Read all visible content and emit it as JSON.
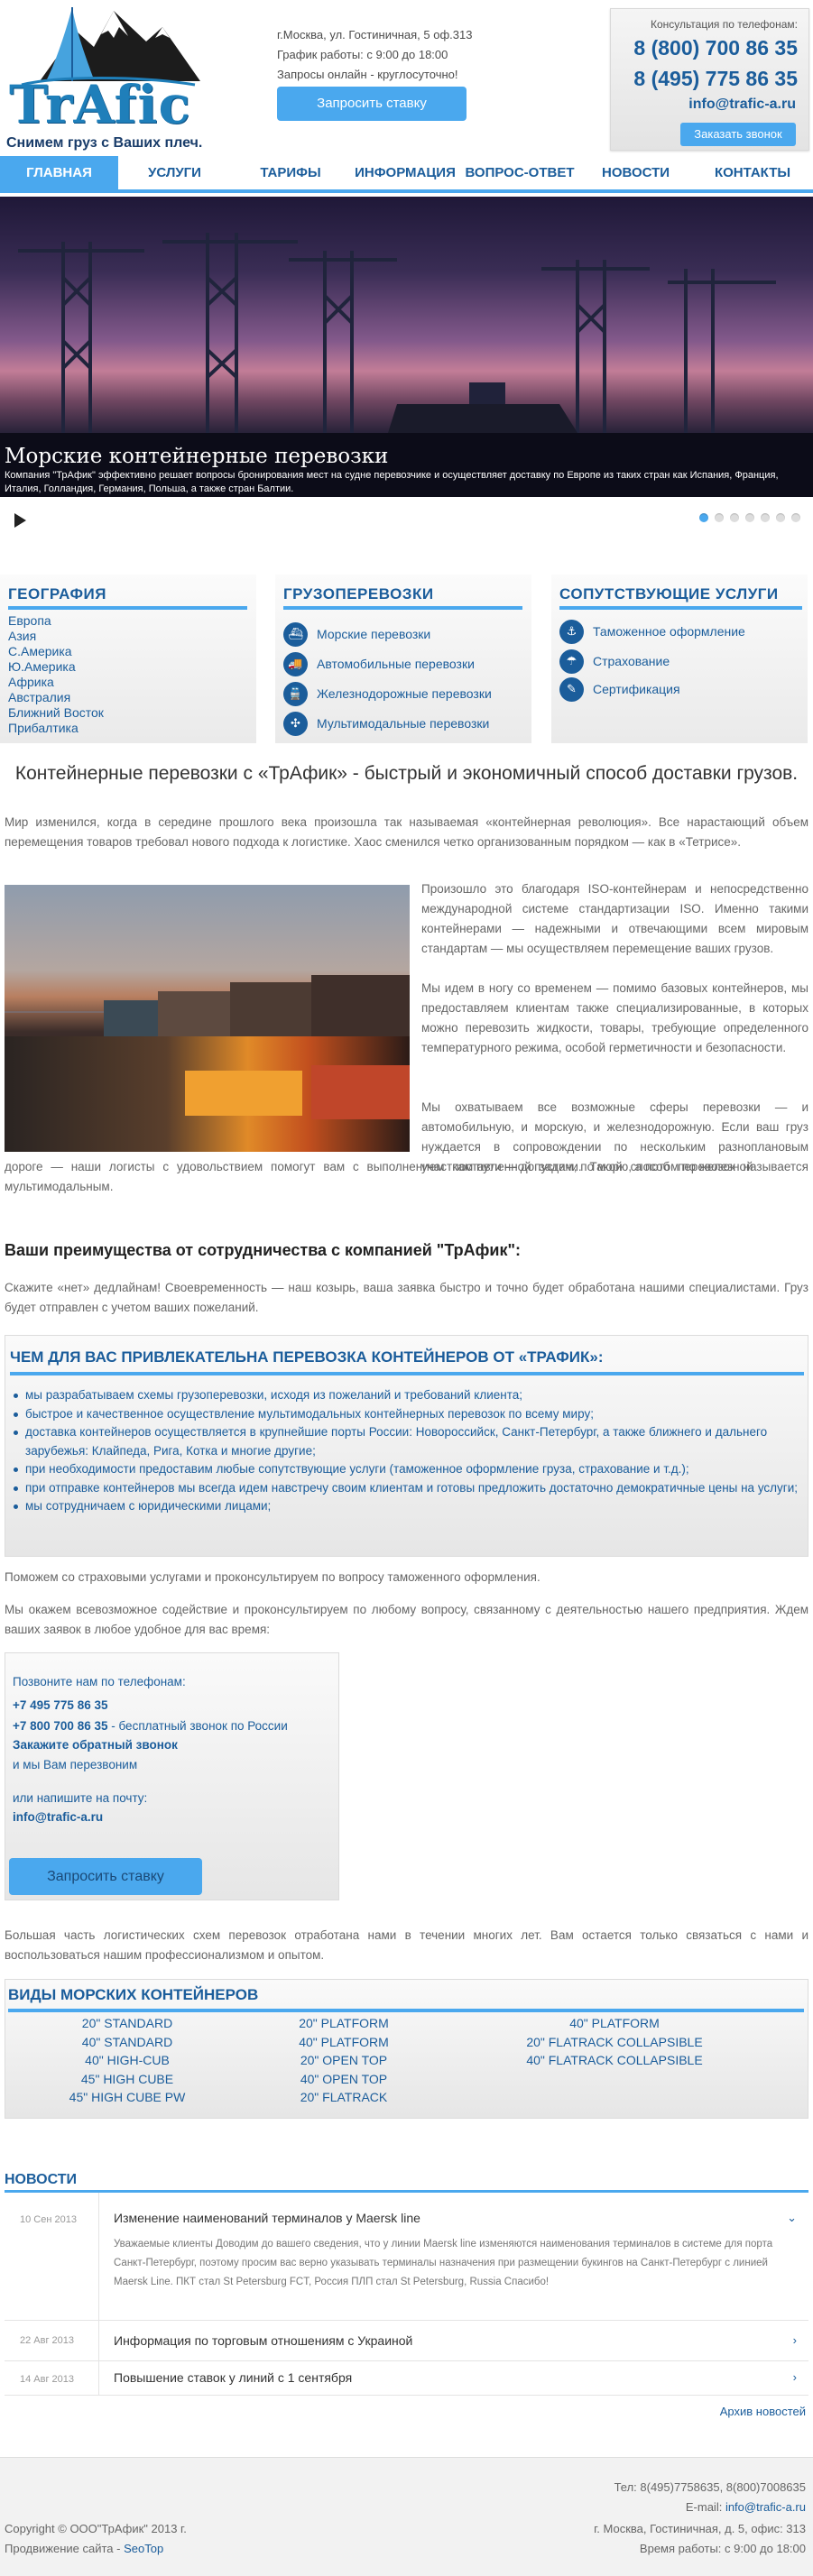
{
  "brand": {
    "name": "TrAfic",
    "slogan": "Снимем груз с Ваших плеч."
  },
  "header": {
    "address": "г.Москва, ул. Гостиничная, 5 оф.313",
    "hours": "График работы: с 9:00 до 18:00",
    "online": "Запросы онлайн - круглосуточно!",
    "rate_button": "Запросить ставку",
    "consult_label": "Консультация по телефонам:",
    "phone1": "8 (800) 700 86 35",
    "phone2": "8 (495) 775 86 35",
    "email": "info@trafic-a.ru",
    "callback_button": "Заказать звонок"
  },
  "nav": [
    "ГЛАВНАЯ",
    "УСЛУГИ",
    "ТАРИФЫ",
    "ИНФОРМАЦИЯ",
    "ВОПРОС-ОТВЕТ",
    "НОВОСТИ",
    "КОНТАКТЫ"
  ],
  "slider": {
    "title": "Морские контейнерные перевозки",
    "description": "Компания \"ТрАфик\" эффективно решает вопросы бронирования мест на судне перевозчике и осуществляет доставку по Европе из таких стран как Испания, Франция, Италия, Голландия, Германия, Польша, а также стран Балтии."
  },
  "geo": {
    "title": "ГЕОГРАФИЯ",
    "items": [
      "Европа",
      "Азия",
      "С.Америка",
      "Ю.Америка",
      "Африка",
      "Австралия",
      "Ближний Восток",
      "Прибалтика"
    ]
  },
  "cargo": {
    "title": "ГРУЗОПЕРЕВОЗКИ",
    "items": [
      "Морские перевозки",
      "Автомобильные перевозки",
      "Железнодорожные перевозки",
      "Мультимодальные перевозки"
    ]
  },
  "services": {
    "title": "СОПУТСТВУЮЩИЕ УСЛУГИ",
    "items": [
      "Таможенное оформление",
      "Страхование",
      "Сертификация"
    ]
  },
  "main": {
    "headline": "Контейнерные перевозки с «ТрАфик» - быстрый и экономичный способ доставки грузов.",
    "intro": "Мир изменился, когда в середине прошлого века произошла так называемая «контейнерная революция». Все нарастающий объем перемещения товаров требовал нового подхода к логистике. Хаос сменился четко организованным порядком — как в «Тетрисе».",
    "p1": "Произошло это благодаря ISO-контейнерам и непосредственно международной системе стандартизации ISO. Именно такими контейнерами — надежными и отвечающими всем мировым стандартам — мы осуществляем перемещение ваших грузов.",
    "p2": "Мы идем в ногу со временем — помимо базовых контейнеров, мы предоставляем клиентам также специализированные, в которых можно перевозить жидкости, товары, требующие определенного температурного режима, особой герметичности и безопасности.",
    "p3a": "Мы охватываем все возможные сферы перевозки — и автомобильную, и морскую, и железнодорожную. Если ваш груз нуждается в сопровождении по нескольким разноплановым участкам пути — допустим, по морю, а потом по железной",
    "p3b": "дороге — наши логисты с удовольствием помогут вам с выполнением поставленной задачи. Такой способ перевозок называется мультимодальным.",
    "adv_title": "Ваши преимущества от сотрудничества с компанией \"ТрАфик\":",
    "adv_text": "Скажите «нет» дедлайнам! Своевременность — наш козырь, ваша заявка быстро и точно будет обработана нашими специалистами. Груз будет отправлен с учетом ваших пожеланий."
  },
  "attract": {
    "title": "ЧЕМ ДЛЯ ВАС ПРИВЛЕКАТЕЛЬНА ПЕРЕВОЗКА КОНТЕЙНЕРОВ ОТ «ТРАФИК»:",
    "items": [
      "мы разрабатываем схемы грузоперевозки, исходя из пожеланий и требований клиента;",
      "быстрое и качественное осуществление мультимодальных контейнерных перевозок по всему миру;",
      "доставка контейнеров осуществляется в крупнейшие порты России: Новороссийск, Санкт-Петербург, а также ближнего и дальнего зарубежья:  Клайпеда, Рига, Котка и многие другие;",
      "при необходимости предоставим любые сопутствующие услуги (таможенное оформление груза, страхование и т.д.);",
      "при отправке контейнеров мы всегда идем навстречу своим клиентам и готовы предложить достаточно демократичные цены на услуги;",
      "мы сотрудничаем с юридическими лицами;"
    ]
  },
  "after": {
    "t1": "Поможем со страховыми услугами и проконсультируем по вопросу таможенного оформления.",
    "t2": "Мы окажем всевозможное содействие и проконсультируем по любому вопросу, связанному с деятельностью нашего предприятия. Ждем ваших заявок в любое удобное для вас время:"
  },
  "callbox": {
    "call_us": "Позвоните нам по телефонам:",
    "phone1": "+7 495 775 86 35",
    "phone2": "+7 800 700 86 35",
    "phone2_note": " - бесплатный звонок по России",
    "order": "Закажите обратный звонок",
    "recall": "и мы Вам перезвоним",
    "or_write": "или напишите на почту:",
    "email": "info@trafic-a.ru",
    "button": "Запросить ставку"
  },
  "closing": "Большая часть логистических схем перевозок отработана нами в течении многих лет. Вам остается только связаться с нами и воспользоваться нашим профессионализмом и опытом.",
  "containers": {
    "title": "ВИДЫ МОРСКИХ КОНТЕЙНЕРОВ",
    "col1": [
      "20\" STANDARD",
      "40\" STANDARD",
      "40\" HIGH-CUB",
      "45\" HIGH CUBE",
      "45\" HIGH CUBE PW"
    ],
    "col2": [
      "20\" PLATFORM",
      "40\" PLATFORM",
      "20\" OPEN TOP",
      "40\" OPEN TOP",
      "20\" FLATRACK"
    ],
    "col3": [
      "40\" PLATFORM",
      "20\" FLATRACK COLLAPSIBLE",
      "40\" FLATRACK COLLAPSIBLE"
    ]
  },
  "news": {
    "title": "НОВОСТИ",
    "items": [
      {
        "date": "10 Сен 2013",
        "title": "Изменение наименований терминалов у Maersk line",
        "text": "Уважаемые клиенты Доводим до вашего сведения, что у линии Maersk line изменяются наименования терминалов в системе для порта Санкт-Петербург, поэтому просим вас верно указывать терминалы назначения при размещении букингов на Санкт-Петербург с линией Maersk Line. ПКТ стал St Petersburg FCT, Россия ПЛП стал St Petersburg, Russia Спасибо!"
      },
      {
        "date": "22 Авг 2013",
        "title": "Информация по торговым отношениям с Украиной"
      },
      {
        "date": "14 Авг 2013",
        "title": "Повышение ставок у линий с 1 сентября"
      }
    ],
    "archive": "Архив новостей"
  },
  "footer": {
    "tel": "Тел: 8(495)7758635, 8(800)7008635",
    "email_label": "E-mail: ",
    "email": "info@trafic-a.ru",
    "address": "г. Москва, Гостиничная, д. 5, офис: 313",
    "hours": "Время работы: с 9:00 до 18:00",
    "copyright": "Copyright © ООО\"ТрАфик\" 2013 г.",
    "promo_label": "Продвижение сайта - ",
    "promo": "SeoTop"
  },
  "colors": {
    "accent": "#4aa8ee",
    "brand": "#1b5d9b"
  }
}
